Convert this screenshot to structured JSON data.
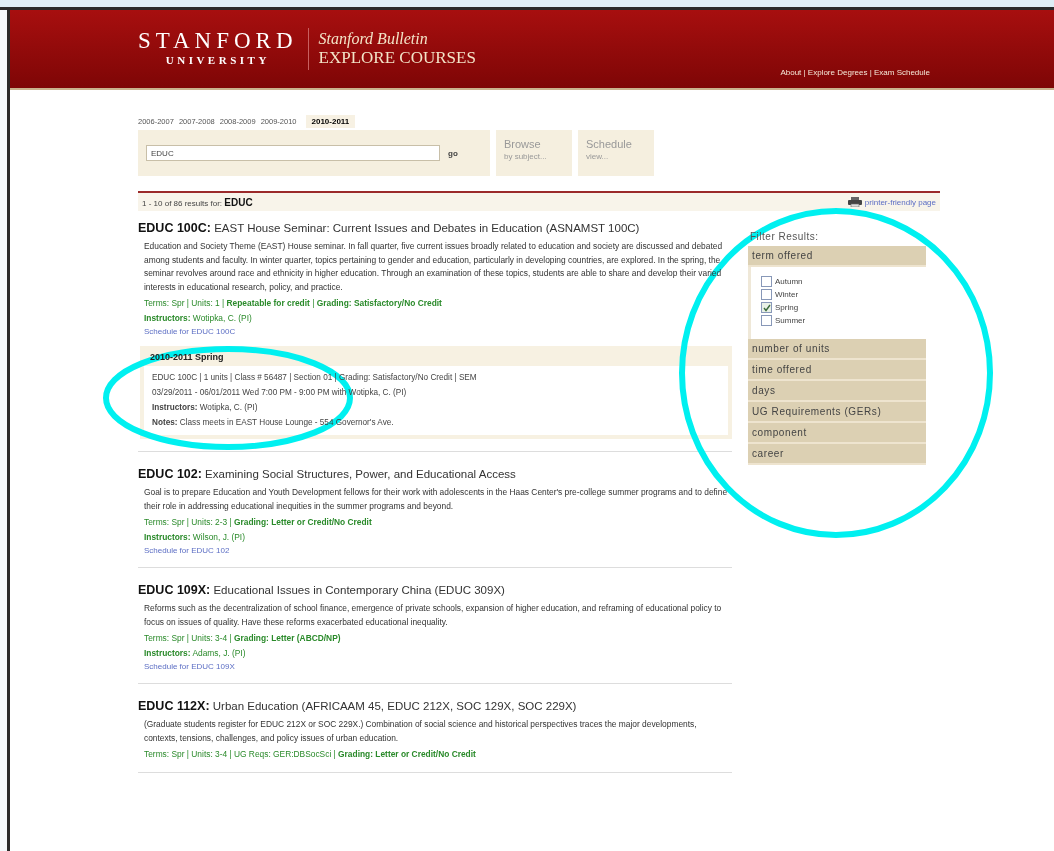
{
  "header": {
    "logo_top": "STANFORD",
    "logo_bottom": "UNIVERSITY",
    "bulletin": "Stanford Bulletin",
    "site": "EXPLORE COURSES",
    "links": "About | Explore Degrees | Exam Schedule"
  },
  "years": [
    {
      "label": "2006-2007",
      "selected": false
    },
    {
      "label": "2007-2008",
      "selected": false
    },
    {
      "label": "2008-2009",
      "selected": false
    },
    {
      "label": "2009-2010",
      "selected": false
    },
    {
      "label": "2010-2011",
      "selected": true
    }
  ],
  "search": {
    "value": "EDUC",
    "go": "go",
    "browse": {
      "title": "Browse",
      "sub": "by subject..."
    },
    "schedule": {
      "title": "Schedule",
      "sub": "view..."
    }
  },
  "results": {
    "summary": "1 - 10 of 86 results for:",
    "query": "EDUC",
    "printer": "printer-friendly page"
  },
  "courses": [
    {
      "code": "EDUC 100C:",
      "title": "EAST House Seminar: Current Issues and Debates in Education (ASNAMST 100C)",
      "description": "Education and Society Theme (EAST) House seminar. In fall quarter, five current issues broadly related to education and society are discussed and debated among students and faculty. In winter quarter, topics pertaining to gender and education, particularly in developing countries, are explored. In the spring, the seminar revolves around race and ethnicity in higher education. Through an examination of these topics, students are able to share and develop their varied interests in educational research, policy, and practice.",
      "meta": "Terms: Spr | Units: 1 | **Repeatable for credit** | **Grading: Satisfactory/No Credit**",
      "instructors": "**Instructors:** Wotipka, C. (PI)",
      "schedule_link": "Schedule for EDUC 100C",
      "section": {
        "title": "2010-2011 Spring",
        "lines": [
          "EDUC 100C | 1 units | Class # 56487 | Section 01 | Grading: Satisfactory/No Credit | SEM",
          "03/29/2011 - 06/01/2011 Wed 7:00 PM - 9:00 PM with Wotipka, C. (PI)",
          "**Instructors:** Wotipka, C. (PI)",
          "**Notes:** Class meets in EAST House Lounge - 554 Governor's Ave."
        ]
      }
    },
    {
      "code": "EDUC 102:",
      "title": "Examining Social Structures, Power, and Educational Access",
      "description": "Goal is to prepare Education and Youth Development fellows for their work with adolescents in the Haas Center's pre-college summer programs and to define their role in addressing educational inequities in the summer programs and beyond.",
      "meta": "Terms: Spr | Units: 2-3 | **Grading: Letter or Credit/No Credit**",
      "instructors": "**Instructors:** Wilson, J. (PI)",
      "schedule_link": "Schedule for EDUC 102"
    },
    {
      "code": "EDUC 109X:",
      "title": "Educational Issues in Contemporary China (EDUC 309X)",
      "description": "Reforms such as the decentralization of school finance, emergence of private schools, expansion of higher education, and reframing of educational policy to focus on issues of quality. Have these reforms exacerbated educational inequality.",
      "meta": "Terms: Spr | Units: 3-4 | **Grading: Letter (ABCD/NP)**",
      "instructors": "**Instructors:** Adams, J. (PI)",
      "schedule_link": "Schedule for EDUC 109X"
    },
    {
      "code": "EDUC 112X:",
      "title": "Urban Education (AFRICAAM 45, EDUC 212X, SOC 129X, SOC 229X)",
      "description": "(Graduate students register for EDUC 212X or SOC 229X.) Combination of social science and historical perspectives traces the major developments, contexts, tensions, challenges, and policy issues of urban education.",
      "meta": "Terms: Spr | Units: 3-4 | UG Reqs: GER:DBSocSci | **Grading: Letter or Credit/No Credit**"
    }
  ],
  "filters": {
    "title": "Filter Results:",
    "groups": [
      {
        "label": "term offered",
        "options": [
          {
            "label": "Autumn",
            "checked": false
          },
          {
            "label": "Winter",
            "checked": false
          },
          {
            "label": "Spring",
            "checked": true
          },
          {
            "label": "Summer",
            "checked": false
          }
        ]
      },
      {
        "label": "number of units"
      },
      {
        "label": "time offered"
      },
      {
        "label": "days"
      },
      {
        "label": "UG Requirements (GERs)"
      },
      {
        "label": "component"
      },
      {
        "label": "career"
      }
    ]
  }
}
